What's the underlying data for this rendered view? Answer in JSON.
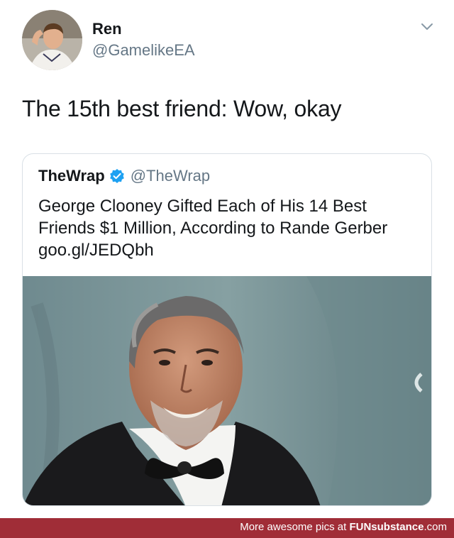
{
  "tweet": {
    "author_name": "Ren",
    "author_handle": "@GamelikeEA",
    "text": "The 15th best friend: Wow, okay"
  },
  "quoted_tweet": {
    "author_name": "TheWrap",
    "author_handle": "@TheWrap",
    "verified": true,
    "text": "George Clooney Gifted Each of His 14 Best Friends $1 Million, According to Rande Gerber",
    "link": "goo.gl/JEDQbh"
  },
  "footer": {
    "prefix": "More awesome pics at ",
    "brand": "FUNsubstance",
    "suffix": ".com"
  },
  "colors": {
    "verified": "#1da1f2",
    "handle": "#657786",
    "footer_bg": "#a02d37"
  },
  "icons": {
    "menu": "chevron-down-icon",
    "verified": "verified-badge-icon"
  }
}
